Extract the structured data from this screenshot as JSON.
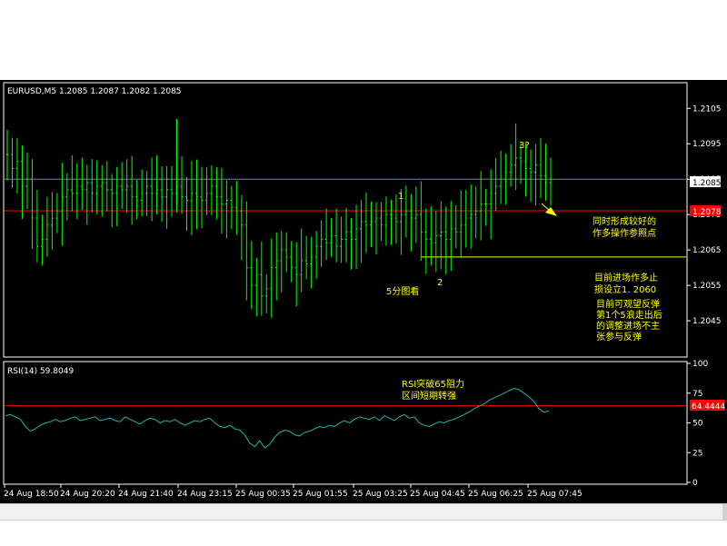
{
  "chart_data": [
    {
      "type": "candlestick",
      "symbol_header": "EURUSD,M5  1.2085 1.2087 1.2082 1.2085",
      "ylim": [
        1.2035,
        1.2112
      ],
      "y_ticks": [
        "1.2105",
        "1.2095",
        "1.2085",
        "1.2075",
        "1.2065",
        "1.2055",
        "1.2045"
      ],
      "current_price": "1.2085",
      "red_level": "1.2078",
      "support_level": 1.2063,
      "x_ticks": [
        "24 Aug 18:50",
        "24 Aug 20:20",
        "24 Aug 21:40",
        "24 Aug 23:15",
        "25 Aug 00:35",
        "25 Aug 01:55",
        "25 Aug 03:25",
        "25 Aug 04:45",
        "25 Aug 06:25",
        "25 Aug 07:45"
      ],
      "close_series": [
        1.2092,
        1.2088,
        1.209,
        1.2083,
        1.2085,
        1.2074,
        1.2066,
        1.2068,
        1.2072,
        1.2074,
        1.2076,
        1.208,
        1.2082,
        1.2081,
        1.2083,
        1.2082,
        1.2084,
        1.2081,
        1.2083,
        1.2084,
        1.2082,
        1.2081,
        1.2083,
        1.2082,
        1.2083,
        1.208,
        1.2079,
        1.2081,
        1.2083,
        1.2081,
        1.2082,
        1.208,
        1.2082,
        1.2081,
        1.2083,
        1.208,
        1.2079,
        1.2081,
        1.208,
        1.2079,
        1.2081,
        1.2083,
        1.208,
        1.2078,
        1.2079,
        1.2077,
        1.2076,
        1.2072,
        1.206,
        1.2055,
        1.2058,
        1.2052,
        1.2054,
        1.206,
        1.2062,
        1.2065,
        1.2063,
        1.206,
        1.2058,
        1.2062,
        1.2061,
        1.2063,
        1.2066,
        1.2068,
        1.2067,
        1.2069,
        1.2066,
        1.2068,
        1.207,
        1.2068,
        1.2071,
        1.2073,
        1.2072,
        1.2073,
        1.2074,
        1.2072,
        1.2075,
        1.2074,
        1.2073,
        1.2075,
        1.2076,
        1.2074,
        1.2075,
        1.207,
        1.2068,
        1.2067,
        1.2069,
        1.207,
        1.2068,
        1.2071,
        1.207,
        1.2072,
        1.2074,
        1.2075,
        1.2076,
        1.2078,
        1.2078,
        1.2081,
        1.2083,
        1.2085,
        1.2087,
        1.2089,
        1.2091,
        1.209,
        1.2088,
        1.2087,
        1.2089,
        1.2086,
        1.2084,
        1.2085
      ],
      "annotations": [
        {
          "text": "1",
          "price": 1.2083,
          "bar": 75
        },
        {
          "text": "2",
          "price": 1.2062,
          "bar": 77
        },
        {
          "text": "3?",
          "price": 1.2095,
          "bar": 94
        },
        {
          "text": "5分图看",
          "price": 1.2058,
          "bar": 68
        }
      ],
      "notes": [
        {
          "lines": [
            "同时形成较好的",
            "作多操作参照点"
          ]
        },
        {
          "lines": [
            "目前进场作多止",
            "损设立1. 2060"
          ]
        },
        {
          "lines": [
            "目前可观望反弹",
            "第1个5浪走出后",
            "的调整进场不主",
            "张参与反弹"
          ]
        }
      ]
    },
    {
      "type": "line",
      "header": "RSI(14)  59.8049",
      "ylim": [
        0,
        100
      ],
      "y_ticks": [
        "100",
        "75",
        "50",
        "25",
        "0"
      ],
      "level": "64.4444",
      "values": [
        56,
        57,
        55,
        53,
        47,
        43,
        45,
        48,
        50,
        51,
        53,
        51,
        52,
        54,
        55,
        52,
        53,
        54,
        55,
        52,
        53,
        54,
        52,
        51,
        55,
        53,
        51,
        49,
        52,
        54,
        53,
        50,
        52,
        51,
        53,
        50,
        48,
        50,
        52,
        51,
        53,
        54,
        50,
        47,
        46,
        48,
        45,
        44,
        40,
        33,
        30,
        35,
        29,
        32,
        38,
        42,
        44,
        43,
        40,
        39,
        42,
        43,
        45,
        47,
        46,
        48,
        47,
        50,
        52,
        50,
        53,
        55,
        54,
        53,
        55,
        52,
        56,
        54,
        52,
        55,
        57,
        54,
        55,
        50,
        48,
        47,
        49,
        51,
        50,
        52,
        53,
        55,
        57,
        59,
        62,
        64,
        66,
        69,
        71,
        73,
        75,
        77,
        79,
        78,
        75,
        72,
        68,
        62,
        59,
        60
      ],
      "annotation": [
        "RSI突破65阻力",
        "区间短期转强"
      ]
    }
  ],
  "colors": {
    "background": "#000000",
    "candle": "#00ff00",
    "rsi_line": "#20b2aa",
    "red_line": "#ff0000",
    "blue_line": "#6b7fb0",
    "support_line": "#ffff00",
    "annotation": "#ffff00",
    "axis_text": "#ffffff",
    "red_label_bg": "#ff0000",
    "current_label_bg": "#ffffff"
  }
}
